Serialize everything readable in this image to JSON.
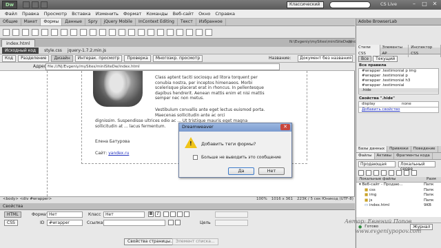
{
  "titlebar": {
    "logo": "Dw",
    "workspace": "Классический",
    "cslive": "CS Live",
    "controls": [
      "–",
      "□",
      "✕"
    ]
  },
  "menu": [
    "Файл",
    "Правка",
    "Просмотр",
    "Вставка",
    "Изменить",
    "Формат",
    "Команды",
    "Веб-сайт",
    "Окно",
    "Справка"
  ],
  "insert_tabs": [
    "Общие",
    "Макет",
    "Формы",
    "Данные",
    "Spry",
    "jQuery Mobile",
    "InContext Editing",
    "Текст",
    "Избранное"
  ],
  "document": {
    "tab": "index.html",
    "path": "N:\\Evgeniy\\mySites\\miniSiteDw\\index.html",
    "close": "✕",
    "source_label": "Исходный код",
    "related_files": [
      "style.css",
      "jquery-1.7.2.min.js"
    ],
    "view_buttons": [
      "Код",
      "Разделение",
      "Дизайн",
      "Интерак. просмотр",
      "Проверка",
      "Многоэкр. просмотр"
    ],
    "title_label": "Название:",
    "title_value": "Документ без названия",
    "address_label": "Адрес:",
    "address_value": "file:///N|/Evgeniy/mySites/miniSiteDw/index.html"
  },
  "content": {
    "para1": "Class aptent taciti sociosqu ad litora torquent per conubia nostra, per inceptos himenaeos. Morbi scelerisque placerat erat in rhoncus. In pellentesque dapibus hendrerit. Aenean mattis enim et nisi mattis semper nec non metus.",
    "para2a": "Vestibulum convallis ante eget lectus euismod porta. Maecenas sollicitudin ante ac orci",
    "para2b": "dignissim. Suspendisse ultrices odio ac ... Ut tristique mauris eget magna sollicitudin at ... lacus fermentum.",
    "signature": "Елена Батурова",
    "site_label": "Сайт:",
    "site_link": "yandex.ru"
  },
  "dialog": {
    "title": "Dreamweaver",
    "message": "Добавить теги формы?",
    "checkbox": "Больше не выводить это сообщение",
    "yes": "Да",
    "no": "Нет"
  },
  "statusbar": {
    "breadcrumb": "<body> <div #wrapper>",
    "zoom": "100%",
    "size": "1016 x 361",
    "info": "223K / 5 сек  Юникод (UTF-8)"
  },
  "properties": {
    "title": "Свойства",
    "html_btn": "HTML",
    "css_btn": "CSS",
    "format_label": "Формат",
    "format_value": "Нет",
    "class_label": "Класс",
    "class_value": "Нет",
    "id_label": "ID",
    "id_value": "#wrapper",
    "link_label": "Ссылка",
    "target_label": "Цель",
    "page_props": "Свойства страницы...",
    "list_item": "Элемент списка..."
  },
  "right_panel": {
    "browserlab": "Adobe BrowserLab",
    "css_tabs": [
      "Стили CSS",
      "Элементы AP",
      "Инспектор CSS"
    ],
    "css_buttons": [
      "Все",
      "Текущий"
    ],
    "rules_header": "Все правила",
    "rules": [
      "#wrapper .testimonial p img",
      "#wrapper .testimonial p",
      "#wrapper .testimonial h3",
      "#wrapper .testimonial",
      ".hide"
    ],
    "props_header": "Свойства \".hide\"",
    "prop_name": "display",
    "prop_value": "none",
    "add_property": "Добавить свойство",
    "files_tabs": [
      "Базы данных",
      "Привязки",
      "Поведение"
    ],
    "files_subtabs": [
      "Файлы",
      "Активы",
      "Фрагменты кода"
    ],
    "site_select": "Продающая",
    "view_select": "Локальный серве",
    "local_files": "Локальные файлы",
    "size_col": "Разм",
    "tree": [
      {
        "name": "Веб-сайт - Продаю...",
        "size": "Папк"
      },
      {
        "name": "css",
        "size": "Папк"
      },
      {
        "name": "img",
        "size": "Папк"
      },
      {
        "name": "js",
        "size": "Папк"
      },
      {
        "name": "index.html",
        "size": "9KB"
      }
    ],
    "footer_ready": "Готово",
    "footer_log": "Журнал"
  },
  "watermark": {
    "line1": "Автор: Евгений Попов",
    "line2": "www.evgeniypopov.com"
  }
}
